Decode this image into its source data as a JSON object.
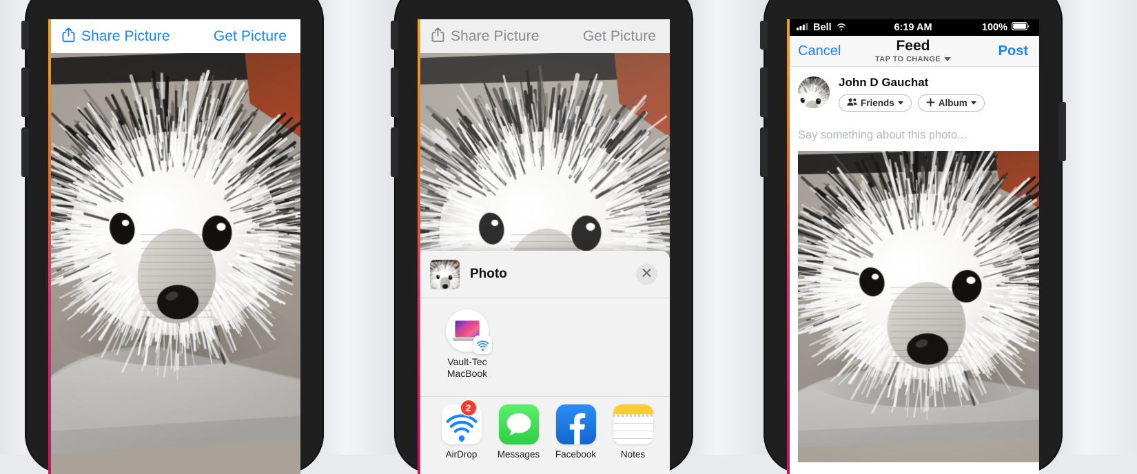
{
  "screens": [
    {
      "id": "screen-one",
      "nav": {
        "share_label": "Share Picture",
        "share_icon": "share-up-arrow-icon",
        "get_label": "Get Picture"
      }
    },
    {
      "id": "screen-two",
      "nav": {
        "share_label": "Share Picture",
        "share_icon": "share-up-arrow-icon",
        "get_label": "Get Picture"
      },
      "share_sheet": {
        "item_title": "Photo",
        "close_icon": "close-x-icon",
        "airdrop_targets": [
          {
            "name": "Vault-Tec\nMacBook",
            "line1": "Vault-Tec",
            "line2": "MacBook",
            "icon": "macbook-icon",
            "badge_icon": "airdrop-icon"
          }
        ],
        "apps": [
          {
            "label": "AirDrop",
            "icon": "airdrop-icon",
            "badge": "2"
          },
          {
            "label": "Messages",
            "icon": "messages-icon",
            "badge": ""
          },
          {
            "label": "Facebook",
            "icon": "facebook-icon",
            "badge": ""
          },
          {
            "label": "Notes",
            "icon": "notes-icon",
            "badge": ""
          },
          {
            "label": "",
            "icon": "google-photos-icon",
            "badge": ""
          }
        ]
      }
    },
    {
      "id": "screen-three",
      "status_bar": {
        "signal_icon": "cellular-bars-icon",
        "carrier": "Bell",
        "wifi_icon": "wifi-icon",
        "time": "6:19 AM",
        "battery_percent": "100%",
        "battery_icon": "battery-full-icon"
      },
      "nav": {
        "cancel_label": "Cancel",
        "title": "Feed",
        "subtitle": "TAP TO CHANGE",
        "subtitle_icon": "chevron-down-icon",
        "post_label": "Post"
      },
      "composer": {
        "avatar_name": "user-avatar",
        "user_name": "John D Gauchat",
        "audience_pill": {
          "label": "Friends",
          "icon": "friends-icon",
          "chevron": "chevron-down-icon"
        },
        "album_pill": {
          "label": "Album",
          "icon": "plus-icon",
          "chevron": "chevron-down-icon"
        },
        "placeholder": "Say something about this photo..."
      }
    }
  ],
  "colors": {
    "ios_blue": "#1a84ff",
    "badge_red": "#fc3b2f",
    "sheet_gray": "#f2f2f2",
    "facebook_blue": "#1877f2",
    "messages_green": "#4cd964",
    "notes_yellow": "#ffcc33",
    "bezel": "#1f1f20"
  }
}
